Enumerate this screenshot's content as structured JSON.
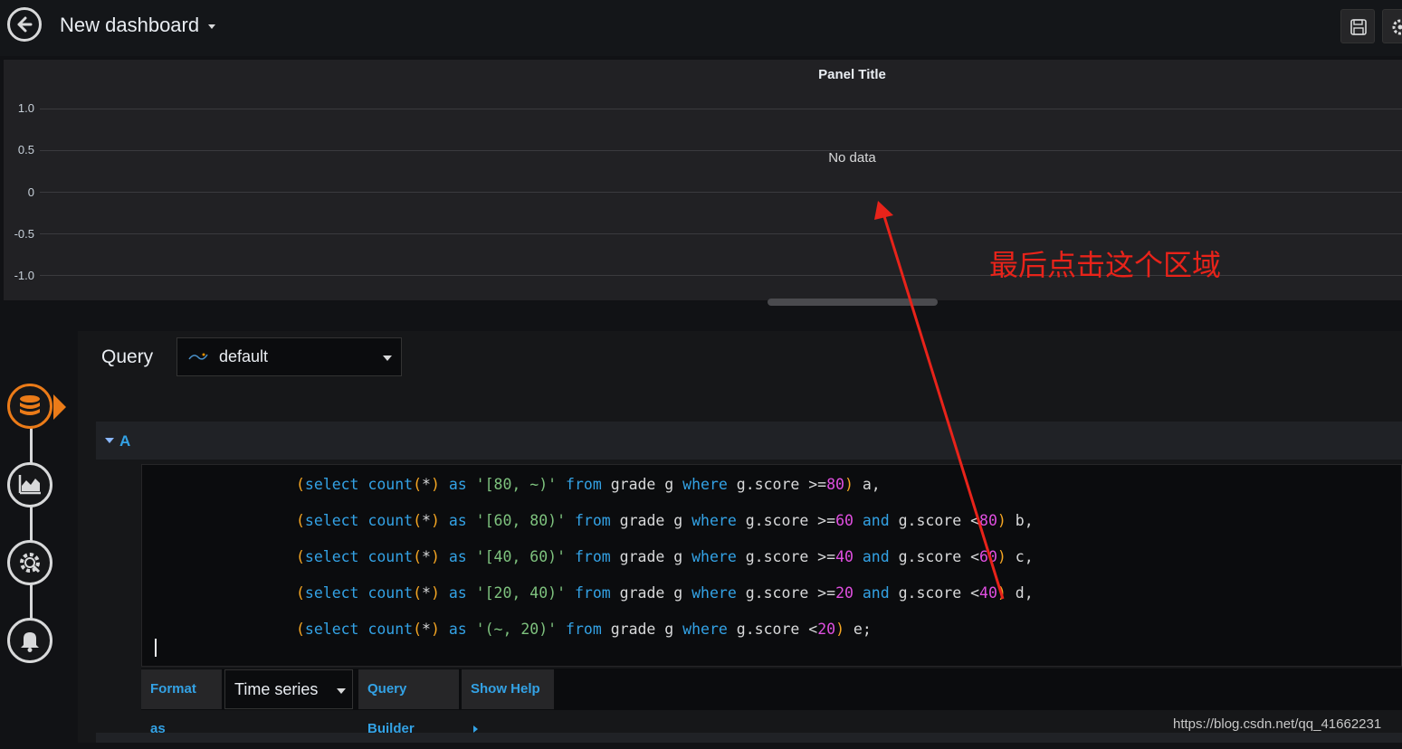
{
  "header": {
    "title": "New dashboard"
  },
  "panel": {
    "title": "Panel Title",
    "no_data": "No data",
    "y_ticks": [
      "1.0",
      "0.5",
      "0",
      "-0.5",
      "-1.0"
    ]
  },
  "editor": {
    "query_label": "Query",
    "datasource": "default",
    "query_ref": "A",
    "code_lines": [
      "(select count(*) as '[80, ~)' from grade g where g.score >=80) a,",
      "(select count(*) as '[60, 80)' from grade g where g.score >=60 and g.score <80) b,",
      "(select count(*) as '[40, 60)' from grade g where g.score >=40 and g.score <60) c,",
      "(select count(*) as '[20, 40)' from grade g where g.score >=20 and g.score <40) d,",
      "(select count(*) as '(~, 20)' from grade g where g.score <20) e;"
    ],
    "format_label": "Format as",
    "format_value": "Time series",
    "query_builder_label": "Query Builder",
    "show_help_label": "Show Help"
  },
  "steps": [
    "database-icon",
    "area-chart-icon",
    "gear-icon",
    "bell-icon"
  ],
  "annotation": {
    "text": "最后点击这个区域"
  },
  "watermark": "https://blog.csdn.net/qq_41662231",
  "colors": {
    "accent_orange": "#eb7b18",
    "link_blue": "#33a2e5",
    "annotation_red": "#e8231a"
  }
}
